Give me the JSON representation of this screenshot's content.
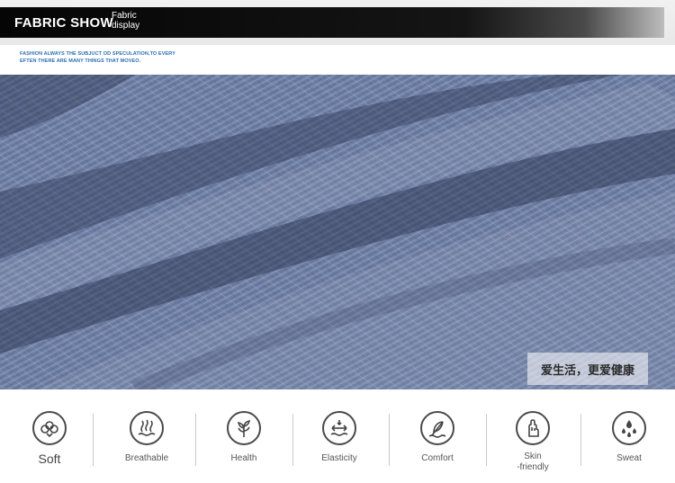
{
  "header": {
    "title": "FABRIC SHOW",
    "subtitle_line1": "Fabric",
    "subtitle_line2": "display"
  },
  "tagline": {
    "line1": "FASHION ALWAYS THE  SUBJUCT OD SPECULATION,TO EVERY",
    "line2": "EFTEN THERE ARE MANY THINGS THAT MOVEO."
  },
  "badge": {
    "text": "爱生活，更爱健康"
  },
  "features": [
    {
      "label": "Soft",
      "icon": "cotton-flower-icon"
    },
    {
      "label": "Breathable",
      "icon": "breathable-waves-icon"
    },
    {
      "label": "Health",
      "icon": "plant-icon"
    },
    {
      "label": "Elasticity",
      "icon": "stretch-arrows-icon"
    },
    {
      "label": "Comfort",
      "icon": "feather-icon"
    },
    {
      "label_line1": "Skin",
      "label_line2": "-friendly",
      "icon": "hand-icon"
    },
    {
      "label": "Sweat",
      "icon": "droplets-icon"
    }
  ],
  "colors": {
    "accent_text": "#2a6fb3",
    "fabric_base": "#6f7fa4",
    "header_bar": "#111111"
  }
}
